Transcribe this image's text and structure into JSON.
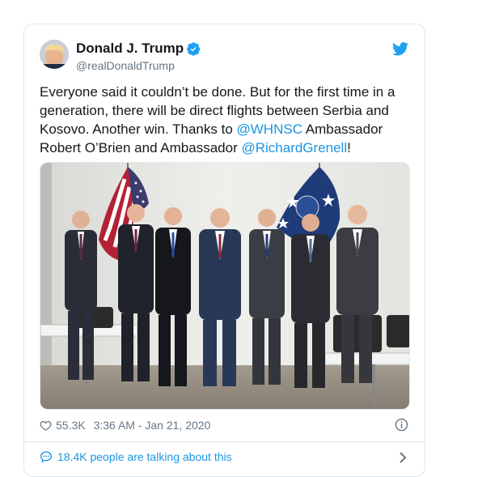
{
  "tweet": {
    "display_name": "Donald J. Trump",
    "handle": "@realDonaldTrump",
    "text_part1": "Everyone said it couldn’t be done. But for the first time in a generation, there will be direct flights between Serbia and Kosovo. Another win. Thanks to ",
    "mention1": "@WHNSC",
    "text_part2": " Ambassador Robert O’Brien and Ambassador ",
    "mention2": "@RichardGrenell",
    "text_part3": "!",
    "likes": "55.3K",
    "timestamp": "3:36 AM - Jan 21, 2020",
    "talking": "18.4K people are talking about this"
  },
  "colors": {
    "link": "#1b95e0",
    "verified": "#1da1f2",
    "muted": "#657786",
    "border": "#e1e8ed"
  },
  "icons": {
    "verified": "verified-badge-icon",
    "bird": "twitter-bird-icon",
    "heart": "heart-icon",
    "info": "info-icon",
    "comment": "comment-bubble-icon",
    "chevron": "chevron-right-icon"
  }
}
